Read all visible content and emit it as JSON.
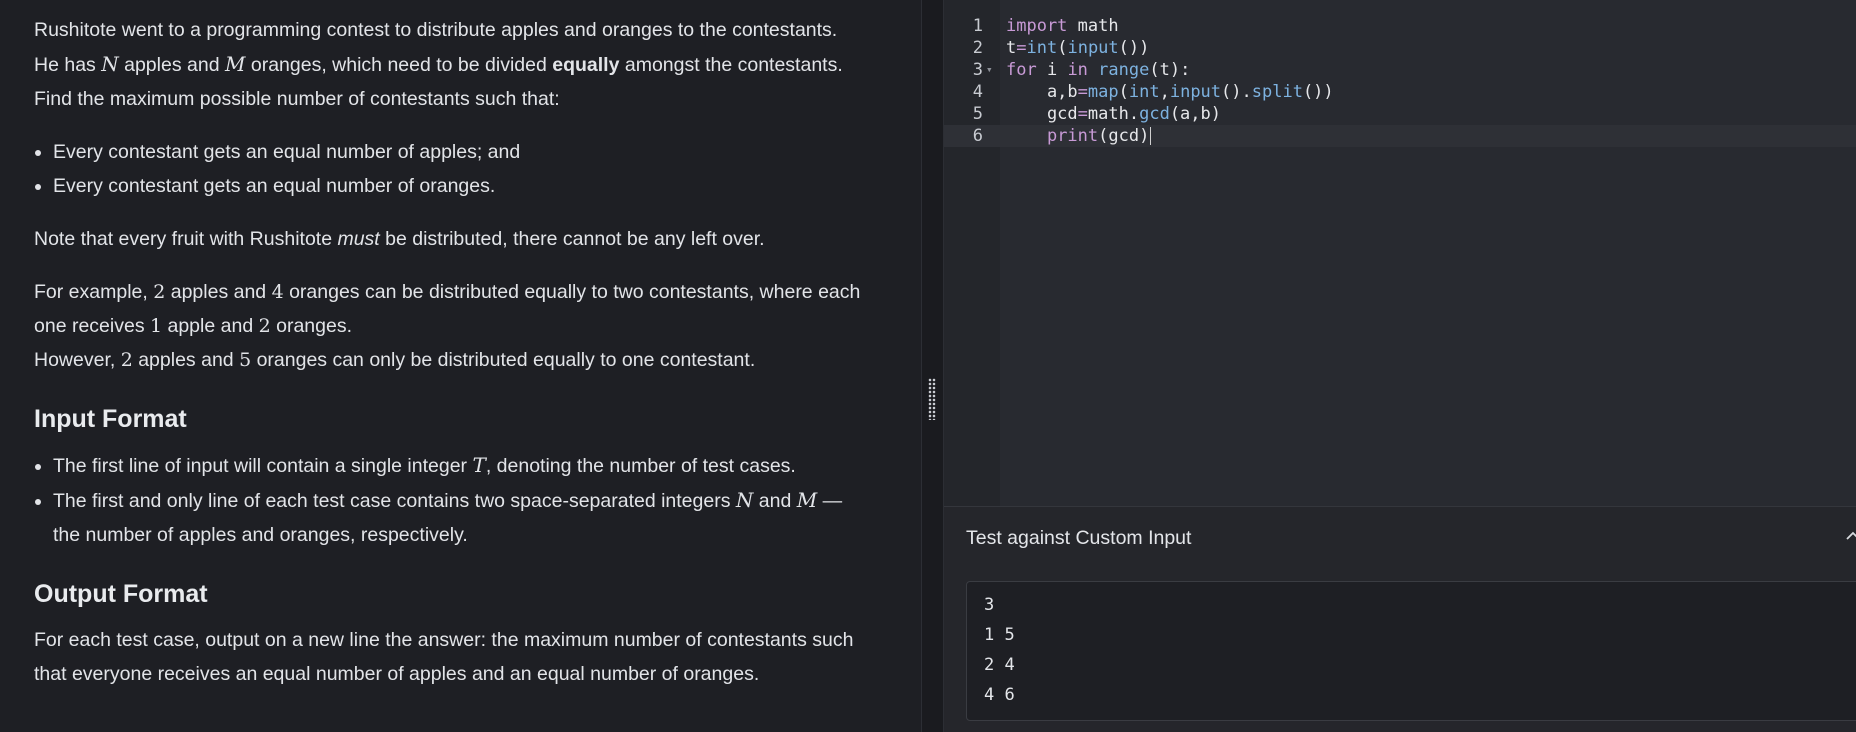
{
  "problem": {
    "intro_1": "Rushitote went to a programming contest to distribute apples and oranges to the contestants.",
    "intro_2a": "He has ",
    "var_N": "N",
    "intro_2b": " apples and ",
    "var_M": "M",
    "intro_2c": " oranges, which need to be divided ",
    "intro_2bold": "equally",
    "intro_2d": " amongst the contestants.",
    "intro_3": "Find the maximum possible number of contestants such that:",
    "bullets": [
      "Every contestant gets an equal number of apples; and",
      "Every contestant gets an equal number of oranges."
    ],
    "note_a": "Note that every fruit with Rushitote ",
    "note_em": "must",
    "note_b": " be distributed, there cannot be any left over.",
    "ex1_a": "For example, ",
    "ex1_n1": "2",
    "ex1_b": " apples and ",
    "ex1_n2": "4",
    "ex1_c": " oranges can be distributed equally to two contestants, where each",
    "ex2_a": "one receives ",
    "ex2_n1": "1",
    "ex2_b": " apple and ",
    "ex2_n2": "2",
    "ex2_c": " oranges.",
    "ex3_a": "However, ",
    "ex3_n1": "2",
    "ex3_b": " apples and ",
    "ex3_n2": "5",
    "ex3_c": " oranges can only be distributed equally to one contestant.",
    "input_heading": "Input Format",
    "in1_a": "The first line of input will contain a single integer ",
    "in1_T": "T",
    "in1_b": ", denoting the number of test cases.",
    "in2_a": "The first and only line of each test case contains two space-separated integers ",
    "in2_N": "N",
    "in2_b": " and ",
    "in2_M": "M",
    "in2_c": " —",
    "in2_d": "the number of apples and oranges, respectively.",
    "output_heading": "Output Format",
    "out_1": "For each test case, output on a new line the answer: the maximum number of contestants such",
    "out_2": "that everyone receives an equal number of apples and an equal number of oranges."
  },
  "editor": {
    "line_numbers": [
      "1",
      "2",
      "3",
      "4",
      "5",
      "6"
    ],
    "lines": {
      "l1_kw": "import",
      "l1_rest": " math",
      "l2_a": "t",
      "l2_op": "=",
      "l2_fn": "int",
      "l2_b": "(",
      "l2_fn2": "input",
      "l2_c": "())",
      "l3_kw": "for",
      "l3_a": " i ",
      "l3_kw2": "in",
      "l3_sp": " ",
      "l3_fn": "range",
      "l3_b": "(t):",
      "l4_a": "    a,b",
      "l4_op": "=",
      "l4_fn": "map",
      "l4_b": "(",
      "l4_fn2": "int",
      "l4_c": ",",
      "l4_fn3": "input",
      "l4_d": "().",
      "l4_fn4": "split",
      "l4_e": "())",
      "l5_a": "    gcd",
      "l5_op": "=",
      "l5_b": "math.",
      "l5_fn": "gcd",
      "l5_c": "(a,b)",
      "l6_sp": "    ",
      "l6_kw": "print",
      "l6_a": "(gcd)"
    }
  },
  "custom_input": {
    "title": "Test against Custom Input",
    "value": "3\n1 5\n2 4\n4 6"
  },
  "colors": {
    "background": "#1e1f24",
    "editor_bg": "#282a30",
    "keyword": "#c89ad6",
    "function": "#7db2e0"
  },
  "icons": {
    "fold": "chevron-down-icon",
    "collapse": "chevron-up-icon",
    "resize": "drag-handle-icon"
  }
}
